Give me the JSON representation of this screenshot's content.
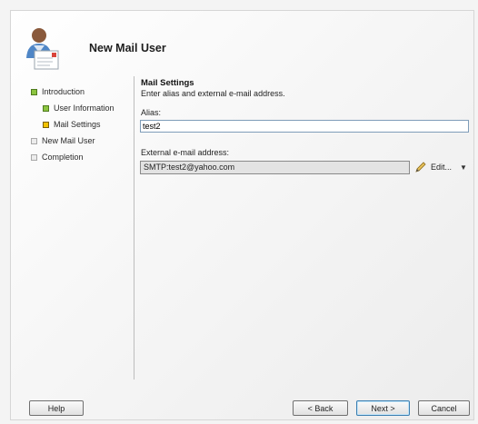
{
  "header": {
    "title": "New Mail User",
    "icon": "mail-user-icon"
  },
  "nav": {
    "items": [
      {
        "label": "Introduction",
        "state": "done",
        "sub": false
      },
      {
        "label": "User Information",
        "state": "done",
        "sub": true
      },
      {
        "label": "Mail Settings",
        "state": "current",
        "sub": true
      },
      {
        "label": "New Mail User",
        "state": "pending",
        "sub": false
      },
      {
        "label": "Completion",
        "state": "pending",
        "sub": false
      }
    ]
  },
  "main": {
    "section_title": "Mail Settings",
    "description": "Enter alias and external e-mail address.",
    "alias_label": "Alias:",
    "alias_value": "test2",
    "external_label": "External e-mail address:",
    "external_value": "SMTP:test2@yahoo.com",
    "edit_label": "Edit..."
  },
  "buttons": {
    "help": "Help",
    "back": "< Back",
    "next": "Next >",
    "cancel": "Cancel"
  }
}
